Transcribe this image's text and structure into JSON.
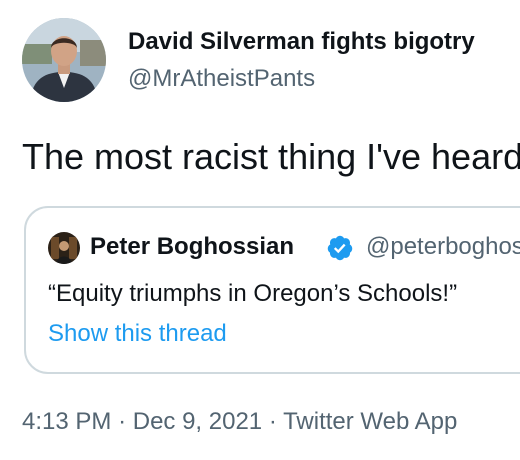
{
  "tweet": {
    "author": {
      "name": "David Silverman fights bigotry",
      "handle": "@MrAtheistPants"
    },
    "text": "The most racist thing I've heard",
    "quoted": {
      "name": "Peter Boghossian",
      "handle": "@peterboghossian",
      "verified": true,
      "text": "“Equity triumphs in Oregon’s Schools!”",
      "show_thread_label": "Show this thread"
    },
    "meta": {
      "time": "4:13 PM",
      "separator": "·",
      "date": "Dec 9, 2021",
      "client": "Twitter Web App"
    }
  },
  "colors": {
    "text": "#0f1419",
    "secondary": "#536471",
    "link": "#1d9bf0",
    "border": "#cfd9de"
  }
}
